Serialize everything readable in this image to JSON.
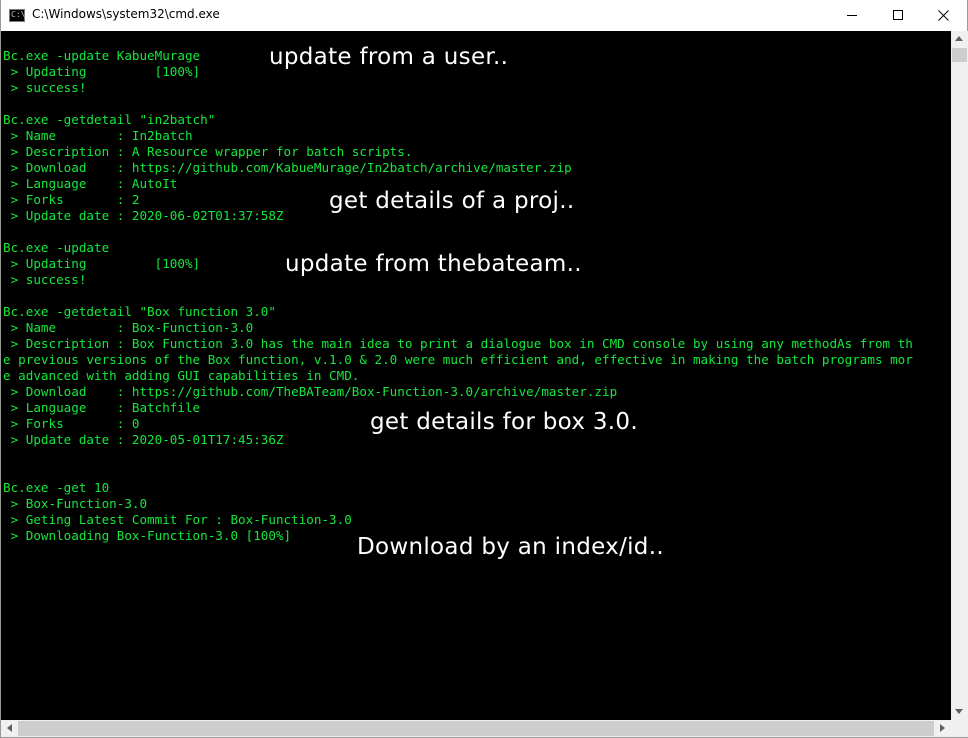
{
  "window": {
    "title": "C:\\Windows\\system32\\cmd.exe",
    "app_icon": "cmd-icon",
    "app_icon_glyph": "C:\\",
    "controls": [
      "minimize-icon",
      "maximize-icon",
      "close-icon"
    ]
  },
  "console": {
    "foreground_color": "#15e83c",
    "background_color": "#000000",
    "lines": [
      "Bc.exe -update KabueMurage",
      " > Updating         [100%]",
      " > success!",
      "",
      "Bc.exe -getdetail \"in2batch\"",
      " > Name        : In2batch",
      " > Description : A Resource wrapper for batch scripts.",
      " > Download    : https://github.com/KabueMurage/In2batch/archive/master.zip",
      " > Language    : AutoIt",
      " > Forks       : 2",
      " > Update date : 2020-06-02T01:37:58Z",
      "",
      "Bc.exe -update",
      " > Updating         [100%]",
      " > success!",
      "",
      "Bc.exe -getdetail \"Box function 3.0\"",
      " > Name        : Box-Function-3.0",
      " > Description : Box Function 3.0 has the main idea to print a dialogue box in CMD console by using any methodAs from th",
      "e previous versions of the Box function, v.1.0 & 2.0 were much efficient and, effective in making the batch programs mor",
      "e advanced with adding GUI capabilities in CMD.",
      " > Download    : https://github.com/TheBATeam/Box-Function-3.0/archive/master.zip",
      " > Language    : Batchfile",
      " > Forks       : 0",
      " > Update date : 2020-05-01T17:45:36Z",
      "",
      "",
      "Bc.exe -get 10",
      " > Box-Function-3.0",
      " > Geting Latest Commit For : Box-Function-3.0",
      " > Downloading Box-Function-3.0 [100%]"
    ]
  },
  "annotations": {
    "update_user": "update from a user..",
    "get_details_proj": "get details of a proj..",
    "update_bateam": "update from thebateam..",
    "get_details_box": "get details for box 3.0.",
    "download_index": "Download by an index/id.."
  }
}
